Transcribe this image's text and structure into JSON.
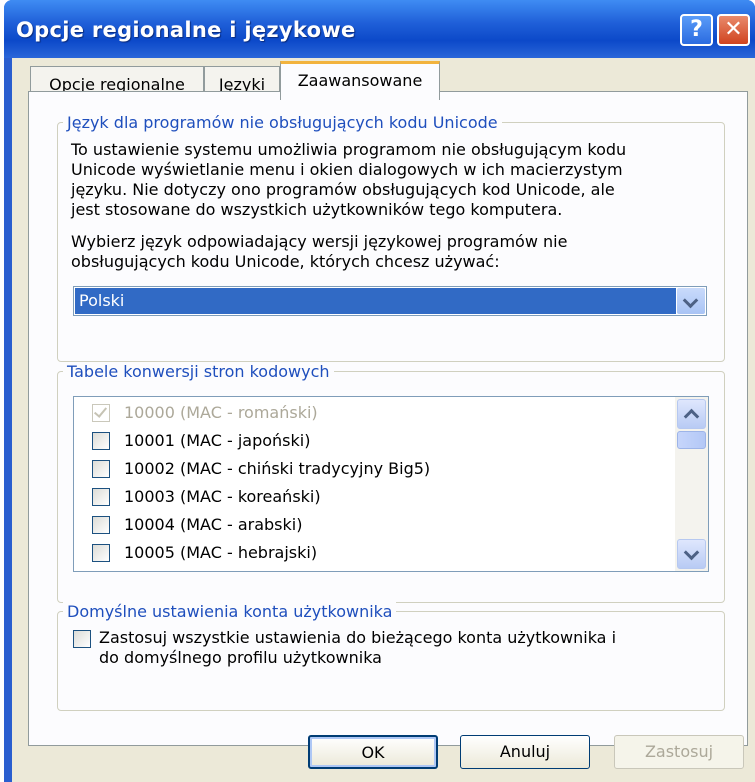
{
  "window": {
    "title": "Opcje regionalne i językowe",
    "help_glyph": "?",
    "close_glyph": "✕"
  },
  "tabs": [
    {
      "label": "Opcje regionalne",
      "active": false
    },
    {
      "label": "Języki",
      "active": false
    },
    {
      "label": "Zaawansowane",
      "active": true
    }
  ],
  "unicode_group": {
    "legend": "Język dla programów nie obsługujących kodu Unicode",
    "description_lines": [
      "To ustawienie systemu umożliwia programom nie obsługującym kodu",
      "Unicode wyświetlanie menu i okien dialogowych w ich macierzystym",
      "języku. Nie dotyczy ono programów obsługujących kod Unicode, ale",
      "jest stosowane do wszystkich użytkowników tego komputera."
    ],
    "prompt_lines": [
      "Wybierz język odpowiadający wersji językowej programów nie",
      "obsługujących kodu Unicode, których chcesz używać:"
    ],
    "selected_language": "Polski"
  },
  "codepage_group": {
    "legend": "Tabele konwersji stron kodowych",
    "items": [
      {
        "label": "10000 (MAC - romański)",
        "checked": true,
        "disabled": true
      },
      {
        "label": "10001 (MAC - japoński)",
        "checked": false,
        "disabled": false
      },
      {
        "label": "10002 (MAC - chiński tradycyjny Big5)",
        "checked": false,
        "disabled": false
      },
      {
        "label": "10003 (MAC - koreański)",
        "checked": false,
        "disabled": false
      },
      {
        "label": "10004 (MAC - arabski)",
        "checked": false,
        "disabled": false
      },
      {
        "label": "10005 (MAC - hebrajski)",
        "checked": false,
        "disabled": false
      }
    ]
  },
  "account_group": {
    "legend": "Domyślne ustawienia konta użytkownika",
    "checkbox_lines": [
      "Zastosuj wszystkie ustawienia do bieżącego konta użytkownika i",
      "do domyślnego profilu użytkownika"
    ],
    "checked": false
  },
  "buttons": {
    "ok": "OK",
    "cancel": "Anuluj",
    "apply": "Zastosuj"
  },
  "colors": {
    "title_bar": "#0c49c9",
    "selection": "#316ac5",
    "group_legend": "#1f4fbd",
    "dialog_bg": "#ece9d8"
  }
}
